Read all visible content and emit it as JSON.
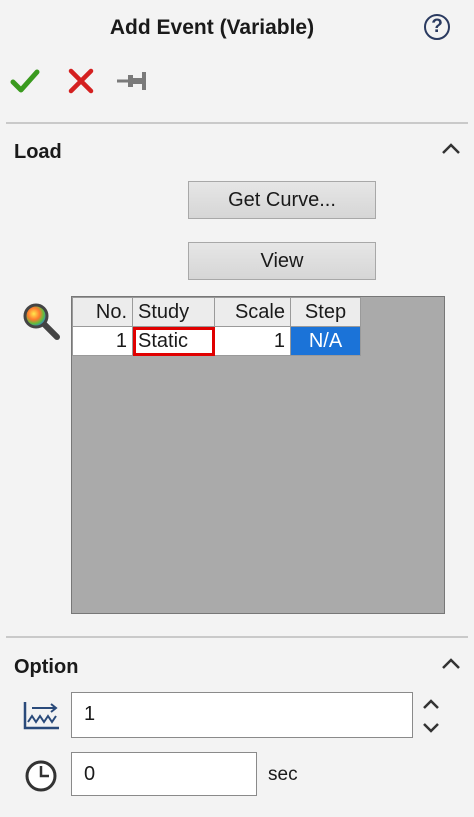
{
  "header": {
    "title": "Add Event (Variable)",
    "help_icon": "help-icon"
  },
  "toolbar": {
    "ok_icon": "checkmark-icon",
    "cancel_icon": "close-icon",
    "pin_icon": "pushpin-icon"
  },
  "load": {
    "label": "Load",
    "buttons": {
      "get_curve": "Get Curve...",
      "view": "View"
    },
    "table": {
      "headers": [
        "No.",
        "Study",
        "Scale",
        "Step"
      ],
      "rows": [
        [
          "1",
          "Static",
          "1",
          "N/A"
        ]
      ]
    }
  },
  "option": {
    "label": "Option",
    "repeat_value": "1",
    "time_value": "0",
    "time_unit": "sec"
  },
  "colors": {
    "check": "#3a9a1e",
    "cancel": "#d42020",
    "selection": "#1b73d8",
    "highlight": "#e00000"
  }
}
